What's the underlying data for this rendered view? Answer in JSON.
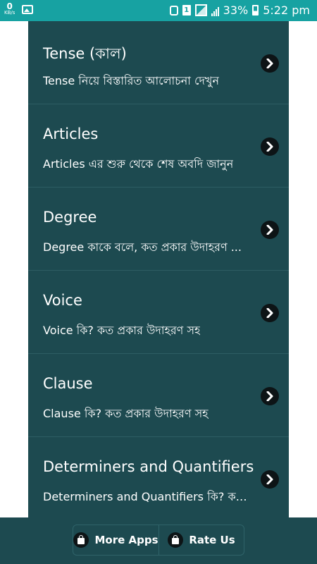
{
  "status_bar": {
    "net_speed": "0",
    "net_unit": "KB/s",
    "sim_label": "1",
    "battery": "33%",
    "time": "5:22 pm"
  },
  "list": {
    "items": [
      {
        "title": "Tense (কাল)",
        "subtitle": "Tense নিয়ে বিস্তারিত আলোচনা দেখুন"
      },
      {
        "title": "Articles",
        "subtitle": "Articles এর শুরু থেকে শেষ অবদি জানুন"
      },
      {
        "title": "Degree",
        "subtitle": "Degree কাকে বলে, কত প্রকার উদাহরণ ..."
      },
      {
        "title": "Voice",
        "subtitle": "Voice কি? কত প্রকার উদাহরণ সহ"
      },
      {
        "title": "Clause",
        "subtitle": "Clause কি? কত প্রকার উদাহরণ সহ"
      },
      {
        "title": "Determiners and Quantifiers",
        "subtitle": "Determiners and Quantifiers কি? কত ..."
      }
    ]
  },
  "bottom_bar": {
    "more_apps_label": "More Apps",
    "rate_us_label": "Rate Us"
  },
  "colors": {
    "status_bar": "#17a2a2",
    "list_background": "#1d4a50",
    "chevron_circle": "#0d1416"
  }
}
